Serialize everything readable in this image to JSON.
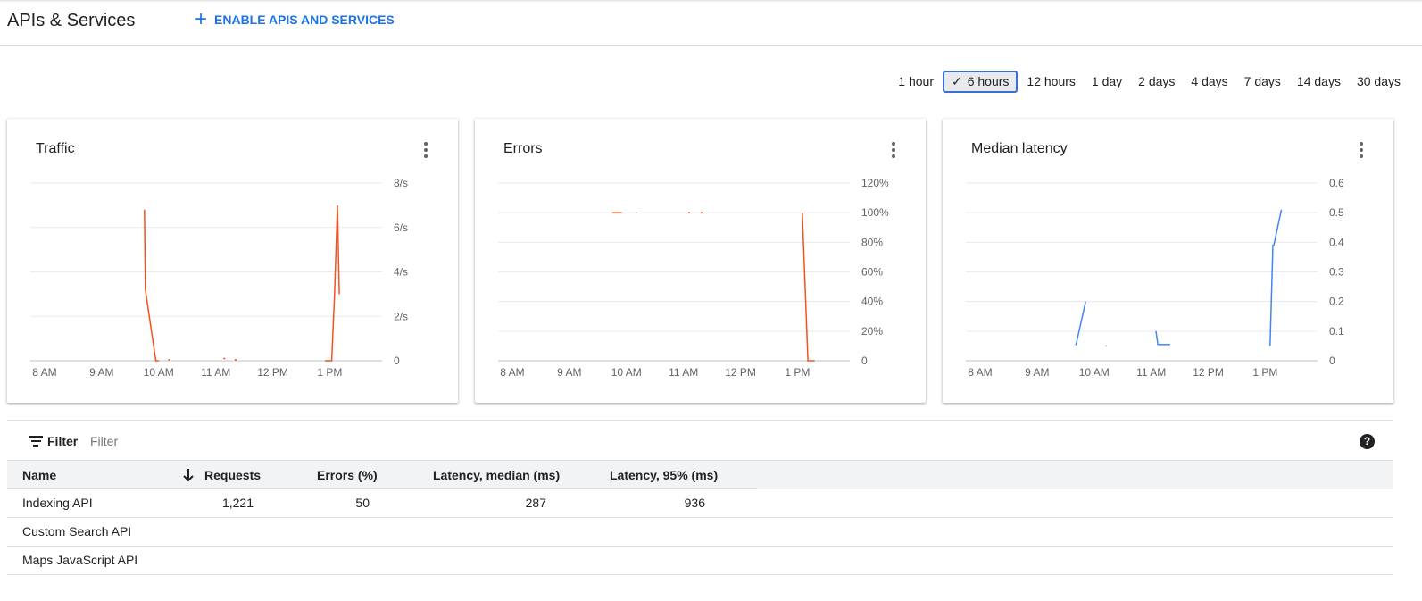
{
  "header": {
    "title": "APIs & Services",
    "enable_button": "ENABLE APIS AND SERVICES",
    "accent_color": "#1a73e8"
  },
  "time_ranges": {
    "options": [
      "1 hour",
      "6 hours",
      "12 hours",
      "1 day",
      "2 days",
      "4 days",
      "7 days",
      "14 days",
      "30 days"
    ],
    "selected": "6 hours"
  },
  "cards": [
    {
      "title": "Traffic"
    },
    {
      "title": "Errors"
    },
    {
      "title": "Median latency"
    }
  ],
  "chart_data": [
    {
      "type": "line",
      "title": "Traffic",
      "x_ticks": [
        "8 AM",
        "9 AM",
        "10 AM",
        "11 AM",
        "12 PM",
        "1 PM"
      ],
      "y_ticks": [
        "0",
        "2/s",
        "4/s",
        "6/s",
        "8/s"
      ],
      "ylim": [
        0,
        8
      ],
      "xlim": [
        "7:45 AM",
        "1:55 PM"
      ],
      "color": "#f4511e",
      "series": [
        {
          "points": [
            [
              "9:45 AM",
              6.8
            ],
            [
              "9:46 AM",
              3.2
            ],
            [
              "9:57 AM",
              0
            ],
            [
              "10:00 AM",
              0
            ]
          ]
        },
        {
          "points": [
            [
              "10:10 AM",
              0.05
            ],
            [
              "10:12 AM",
              0.05
            ]
          ]
        },
        {
          "points": [
            [
              "11:08 AM",
              0.1
            ],
            [
              "11:10 AM",
              0.1
            ]
          ]
        },
        {
          "points": [
            [
              "11:20 AM",
              0.05
            ],
            [
              "11:22 AM",
              0.05
            ]
          ]
        },
        {
          "points": [
            [
              "12:55 PM",
              0
            ],
            [
              "13:02 PM",
              0
            ],
            [
              "13:05 PM",
              3.0
            ],
            [
              "13:08 PM",
              7.0
            ],
            [
              "13:10 PM",
              3.0
            ]
          ]
        }
      ],
      "grid": true
    },
    {
      "type": "line",
      "title": "Errors",
      "x_ticks": [
        "8 AM",
        "9 AM",
        "10 AM",
        "11 AM",
        "12 PM",
        "1 PM"
      ],
      "y_ticks": [
        "0",
        "20%",
        "40%",
        "60%",
        "80%",
        "100%",
        "120%"
      ],
      "ylim": [
        0,
        120
      ],
      "xlim": [
        "7:45 AM",
        "1:55 PM"
      ],
      "color": "#f4511e",
      "series": [
        {
          "points": [
            [
              "9:45 AM",
              100
            ],
            [
              "9:55 AM",
              100
            ]
          ]
        },
        {
          "points": [
            [
              "10:10 AM",
              100
            ],
            [
              "10:11 AM",
              100
            ]
          ]
        },
        {
          "points": [
            [
              "11:05 AM",
              100
            ],
            [
              "11:07 AM",
              100
            ]
          ]
        },
        {
          "points": [
            [
              "11:18 AM",
              100
            ],
            [
              "11:20 AM",
              100
            ]
          ]
        },
        {
          "points": [
            [
              "13:05 PM",
              100
            ],
            [
              "13:11 PM",
              0
            ],
            [
              "13:18 PM",
              0
            ]
          ]
        }
      ],
      "grid": true
    },
    {
      "type": "line",
      "title": "Median latency",
      "x_ticks": [
        "8 AM",
        "9 AM",
        "10 AM",
        "11 AM",
        "12 PM",
        "1 PM"
      ],
      "y_ticks": [
        "0",
        "0.1",
        "0.2",
        "0.3",
        "0.4",
        "0.5",
        "0.6"
      ],
      "ylim": [
        0,
        0.6
      ],
      "xlim": [
        "7:45 AM",
        "1:55 PM"
      ],
      "color": "#4285f4",
      "series": [
        {
          "points": [
            [
              "9:40 AM",
              0.055
            ],
            [
              "9:41 AM",
              0.055
            ],
            [
              "9:51 AM",
              0.2
            ]
          ]
        },
        {
          "points": [
            [
              "10:12 AM",
              0.05
            ],
            [
              "10:13 AM",
              0.05
            ]
          ]
        },
        {
          "points": [
            [
              "11:05 AM",
              0.1
            ],
            [
              "11:07 AM",
              0.055
            ],
            [
              "11:20 AM",
              0.055
            ]
          ]
        },
        {
          "points": [
            [
              "13:05 PM",
              0.05
            ],
            [
              "13:08 PM",
              0.39
            ],
            [
              "13:09 PM",
              0.39
            ],
            [
              "13:17 PM",
              0.51
            ]
          ]
        }
      ],
      "grid": true
    }
  ],
  "filter": {
    "label": "Filter",
    "placeholder": "Filter"
  },
  "table": {
    "columns": [
      "Name",
      "Requests",
      "Errors (%)",
      "Latency, median (ms)",
      "Latency, 95% (ms)"
    ],
    "rows": [
      {
        "name": "Indexing API",
        "requests": "1,221",
        "errors": "50",
        "latency_median": "287",
        "latency_95": "936"
      },
      {
        "name": "Custom Search API",
        "requests": "",
        "errors": "",
        "latency_median": "",
        "latency_95": ""
      },
      {
        "name": "Maps JavaScript API",
        "requests": "",
        "errors": "",
        "latency_median": "",
        "latency_95": ""
      }
    ]
  }
}
